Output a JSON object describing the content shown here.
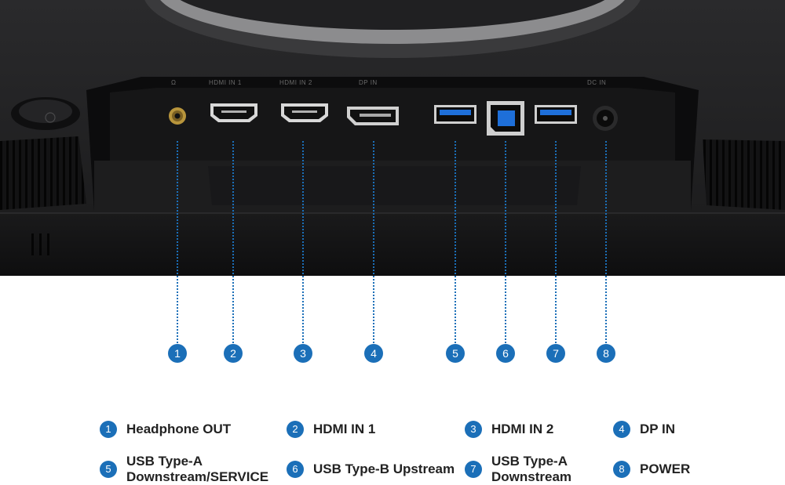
{
  "ports": [
    {
      "num": "1",
      "label": "Headphone OUT",
      "icon": "headphone-jack-icon"
    },
    {
      "num": "2",
      "label": "HDMI IN 1",
      "icon": "hdmi-port-icon"
    },
    {
      "num": "3",
      "label": "HDMI IN 2",
      "icon": "hdmi-port-icon"
    },
    {
      "num": "4",
      "label": "DP IN",
      "icon": "displayport-icon"
    },
    {
      "num": "5",
      "label": "USB Type-A\nDownstream/SERVICE",
      "icon": "usb-a-port-icon"
    },
    {
      "num": "6",
      "label": "USB Type-B Upstream",
      "icon": "usb-b-port-icon"
    },
    {
      "num": "7",
      "label": "USB Type-A\nDownstream",
      "icon": "usb-a-port-icon"
    },
    {
      "num": "8",
      "label": "POWER",
      "icon": "power-input-icon"
    }
  ],
  "panel_labels": {
    "hdmi1": "HDMI IN 1",
    "hdmi2": "HDMI IN 2",
    "dp": "DP IN",
    "power": "DC IN"
  },
  "colors": {
    "accent": "#1b6fb8",
    "usb3_blue": "#1e6fd9",
    "panel": "#1a1a1a"
  }
}
